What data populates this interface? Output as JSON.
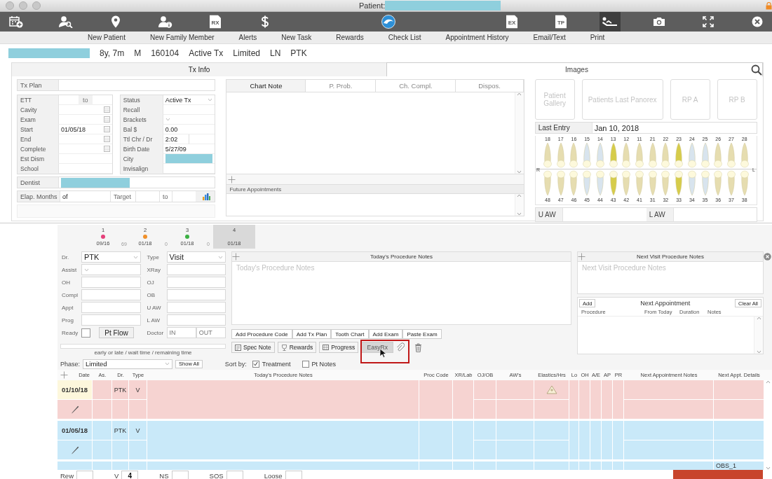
{
  "window": {
    "title": "Patient:"
  },
  "toolbar": {
    "groups": [
      [
        {
          "kind": "calendar",
          "selected": false
        },
        {
          "kind": "person-search",
          "selected": false
        },
        {
          "kind": "pin",
          "selected": false
        },
        {
          "kind": "person-info",
          "selected": false
        },
        {
          "kind": "document",
          "text": "RX",
          "selected": false
        },
        {
          "kind": "dollar",
          "selected": false
        }
      ],
      [
        {
          "kind": "wave",
          "selected": false
        }
      ],
      [
        {
          "kind": "document",
          "text": "EX",
          "selected": false
        },
        {
          "kind": "document",
          "text": "TP",
          "selected": false
        },
        {
          "kind": "recliner",
          "selected": true
        },
        {
          "kind": "camera",
          "selected": false
        },
        {
          "kind": "expand",
          "selected": false
        },
        {
          "kind": "close",
          "selected": false
        }
      ]
    ],
    "labels": [
      "New Patient",
      "New Family Member",
      "Alerts",
      "New Task",
      "Rewards",
      "Check List",
      "Appointment History",
      "Email/Text",
      "Print"
    ]
  },
  "patient": {
    "info": [
      "8y, 7m",
      "M",
      "160104",
      "Active Tx",
      "Limited",
      "LN",
      "PTK"
    ]
  },
  "tx_info": {
    "tab": "Tx Info",
    "tx_plan": {
      "label": "Tx Plan"
    },
    "left_fields": [
      {
        "label": "ETT",
        "kind": "range",
        "joiner": "to"
      },
      {
        "label": "Cavity",
        "kind": "date"
      },
      {
        "label": "Exam",
        "kind": "date"
      },
      {
        "label": "Start",
        "kind": "date",
        "value": "01/05/18"
      },
      {
        "label": "End",
        "kind": "date"
      },
      {
        "label": "Complete",
        "kind": "date"
      },
      {
        "label": "Est Dism",
        "kind": "text"
      },
      {
        "label": "School",
        "kind": "text"
      }
    ],
    "right_fields": [
      {
        "label": "Status",
        "kind": "select",
        "value": "Active Tx"
      },
      {
        "label": "Recall",
        "kind": "text"
      },
      {
        "label": "Brackets",
        "kind": "select"
      },
      {
        "label": "Bal $",
        "kind": "text",
        "value": "0.00"
      },
      {
        "label": "Ttl Chr / Dr",
        "kind": "split",
        "value": "2:02"
      },
      {
        "label": "Birth Date",
        "kind": "text",
        "value": "5/27/09"
      },
      {
        "label": "City",
        "kind": "redacted"
      },
      {
        "label": "Invisalign",
        "kind": "text"
      }
    ],
    "dentist": {
      "label": "Dentist"
    },
    "elapsed": {
      "label": "Elap. Months",
      "value": "of",
      "target_label": "Target",
      "to_label": "to"
    }
  },
  "chart_note": {
    "tabs": [
      {
        "label": "Chart Note",
        "selected": true
      },
      {
        "label": "P. Prob.",
        "selected": false
      },
      {
        "label": "Ch. Compl.",
        "selected": false
      },
      {
        "label": "Dispos.",
        "selected": false
      }
    ],
    "future_appointments": "Future Appointments"
  },
  "images": {
    "tab": "Images",
    "buttons": [
      "Patient Gallery",
      "Patients Last Panorex",
      "RP A",
      "RP B"
    ],
    "last_entry": {
      "label": "Last Entry",
      "value": "Jan 10, 2018"
    },
    "side_labels": [
      "R",
      "L"
    ],
    "upper_teeth": [
      {
        "number": "18",
        "color": "#e6ddb0"
      },
      {
        "number": "17",
        "color": "#e6ddb0"
      },
      {
        "number": "16",
        "color": "#e6ddb0"
      },
      {
        "number": "15",
        "color": "#d8e4ee"
      },
      {
        "number": "14",
        "color": "#d8e4ee"
      },
      {
        "number": "13",
        "color": "#d6cc4a"
      },
      {
        "number": "12",
        "color": "#e6ddb0"
      },
      {
        "number": "11",
        "color": "#e6ddb0"
      },
      {
        "number": "21",
        "color": "#e6ddb0"
      },
      {
        "number": "22",
        "color": "#e6ddb0"
      },
      {
        "number": "23",
        "color": "#d6cc4a"
      },
      {
        "number": "24",
        "color": "#d8e4ee"
      },
      {
        "number": "25",
        "color": "#d8e4ee"
      },
      {
        "number": "26",
        "color": "#e6ddb0"
      },
      {
        "number": "27",
        "color": "#e6ddb0"
      },
      {
        "number": "28",
        "color": "#e6ddb0"
      }
    ],
    "lower_teeth": [
      {
        "number": "48",
        "color": "#e6ddb0"
      },
      {
        "number": "47",
        "color": "#e6ddb0"
      },
      {
        "number": "46",
        "color": "#e6ddb0"
      },
      {
        "number": "45",
        "color": "#d8e4ee"
      },
      {
        "number": "44",
        "color": "#d8e4ee"
      },
      {
        "number": "43",
        "color": "#d6cc4a"
      },
      {
        "number": "42",
        "color": "#e6ddb0"
      },
      {
        "number": "41",
        "color": "#e6ddb0"
      },
      {
        "number": "31",
        "color": "#e6ddb0"
      },
      {
        "number": "32",
        "color": "#e6ddb0"
      },
      {
        "number": "33",
        "color": "#d6cc4a"
      },
      {
        "number": "34",
        "color": "#d8e4ee"
      },
      {
        "number": "35",
        "color": "#d8e4ee"
      },
      {
        "number": "36",
        "color": "#e6ddb0"
      },
      {
        "number": "37",
        "color": "#e6ddb0"
      },
      {
        "number": "38",
        "color": "#e6ddb0"
      }
    ],
    "airway": [
      "U AW",
      "L AW"
    ]
  },
  "visits": {
    "tabs": [
      {
        "number": "1",
        "color": "#e5407a",
        "date": "09/16",
        "selected": false,
        "gap": "69"
      },
      {
        "number": "2",
        "color": "#f0902a",
        "date": "01/18",
        "selected": false,
        "gap": "0"
      },
      {
        "number": "3",
        "color": "#3cb043",
        "date": "01/18",
        "selected": false,
        "gap": "0"
      },
      {
        "number": "4",
        "date": "01/18",
        "selected": true
      }
    ]
  },
  "visit_form": {
    "left": [
      {
        "label": "Dr.",
        "kind": "select",
        "value": "PTK"
      },
      {
        "label": "Assist",
        "kind": "select"
      },
      {
        "label": "OH",
        "kind": "text"
      },
      {
        "label": "Compl",
        "kind": "text"
      },
      {
        "label": "Appt",
        "kind": "text"
      },
      {
        "label": "Prog",
        "kind": "text"
      }
    ],
    "right": [
      {
        "label": "Type",
        "kind": "select",
        "value": "Visit"
      },
      {
        "label": "XRay",
        "kind": "text"
      },
      {
        "label": "OJ",
        "kind": "text"
      },
      {
        "label": "OB",
        "kind": "text"
      },
      {
        "label": "U AW",
        "kind": "text"
      },
      {
        "label": "L AW",
        "kind": "text"
      }
    ],
    "ready": {
      "label": "Ready",
      "checked": false,
      "button": "Pt Flow"
    },
    "doctor": {
      "label": "Doctor",
      "in_placeholder": "IN",
      "out_placeholder": "OUT"
    },
    "caption": "early or late / wait time / remaining time"
  },
  "procedure_notes": {
    "title": "Today's Procedure Notes",
    "placeholder": "Today's Procedure Notes",
    "buttons": [
      "Add Procedure Code",
      "Add Tx Plan",
      "Tooth Chart",
      "Add Exam",
      "Paste Exam"
    ],
    "actions": [
      {
        "label": "Spec Note",
        "kind": "note",
        "pressed": false
      },
      {
        "label": "Rewards",
        "kind": "trophy",
        "pressed": false
      },
      {
        "label": "Progress",
        "kind": "grid",
        "pressed": false
      },
      {
        "label": "EasyRx",
        "kind": "plain",
        "pressed": true
      }
    ]
  },
  "next_visit": {
    "title": "Next Visit Procedure Notes",
    "placeholder": "Next Visit Procedure Notes",
    "next_appointment": {
      "add": "Add",
      "title": "Next Appointment",
      "clear": "Clear All",
      "columns": [
        "Procedure",
        "From Today",
        "Duration",
        "Notes"
      ]
    }
  },
  "filters": {
    "phase_label": "Phase:",
    "phase": "Limited",
    "show_all": "Show All",
    "sort_label": "Sort by:",
    "sort_options": [
      {
        "label": "Treatment",
        "checked": true
      },
      {
        "label": "Pt Notes",
        "checked": false
      }
    ]
  },
  "table": {
    "columns": [
      "Date",
      "As.",
      "Dr.",
      "Type",
      "Today's Procedure Notes",
      "Proc Code",
      "XR/Lab",
      "OJ/OB",
      "AW's",
      "Elastics/Hrs",
      "Lo",
      "OH",
      "A/E",
      "AP",
      "PR",
      "Next Appointment Notes",
      "Next Appt. Details"
    ],
    "rows": [
      {
        "date": "01/10/18",
        "doctor": "PTK",
        "type": "V",
        "color": "#f6d3d1",
        "selected": true,
        "warning": true
      },
      {
        "date": "01/05/18",
        "doctor": "PTK",
        "type": "V",
        "color": "#c9e9f9",
        "selected": false,
        "warning": false
      },
      {
        "color": "#c9e9f9",
        "selected": false,
        "warning": false,
        "next_appt_details": "OBS_1"
      }
    ]
  },
  "footer": {
    "fields": [
      {
        "label": "Rew"
      },
      {
        "label": "V",
        "value": "4"
      },
      {
        "label": "NS"
      },
      {
        "label": "SOS"
      },
      {
        "label": "Loose"
      }
    ]
  }
}
